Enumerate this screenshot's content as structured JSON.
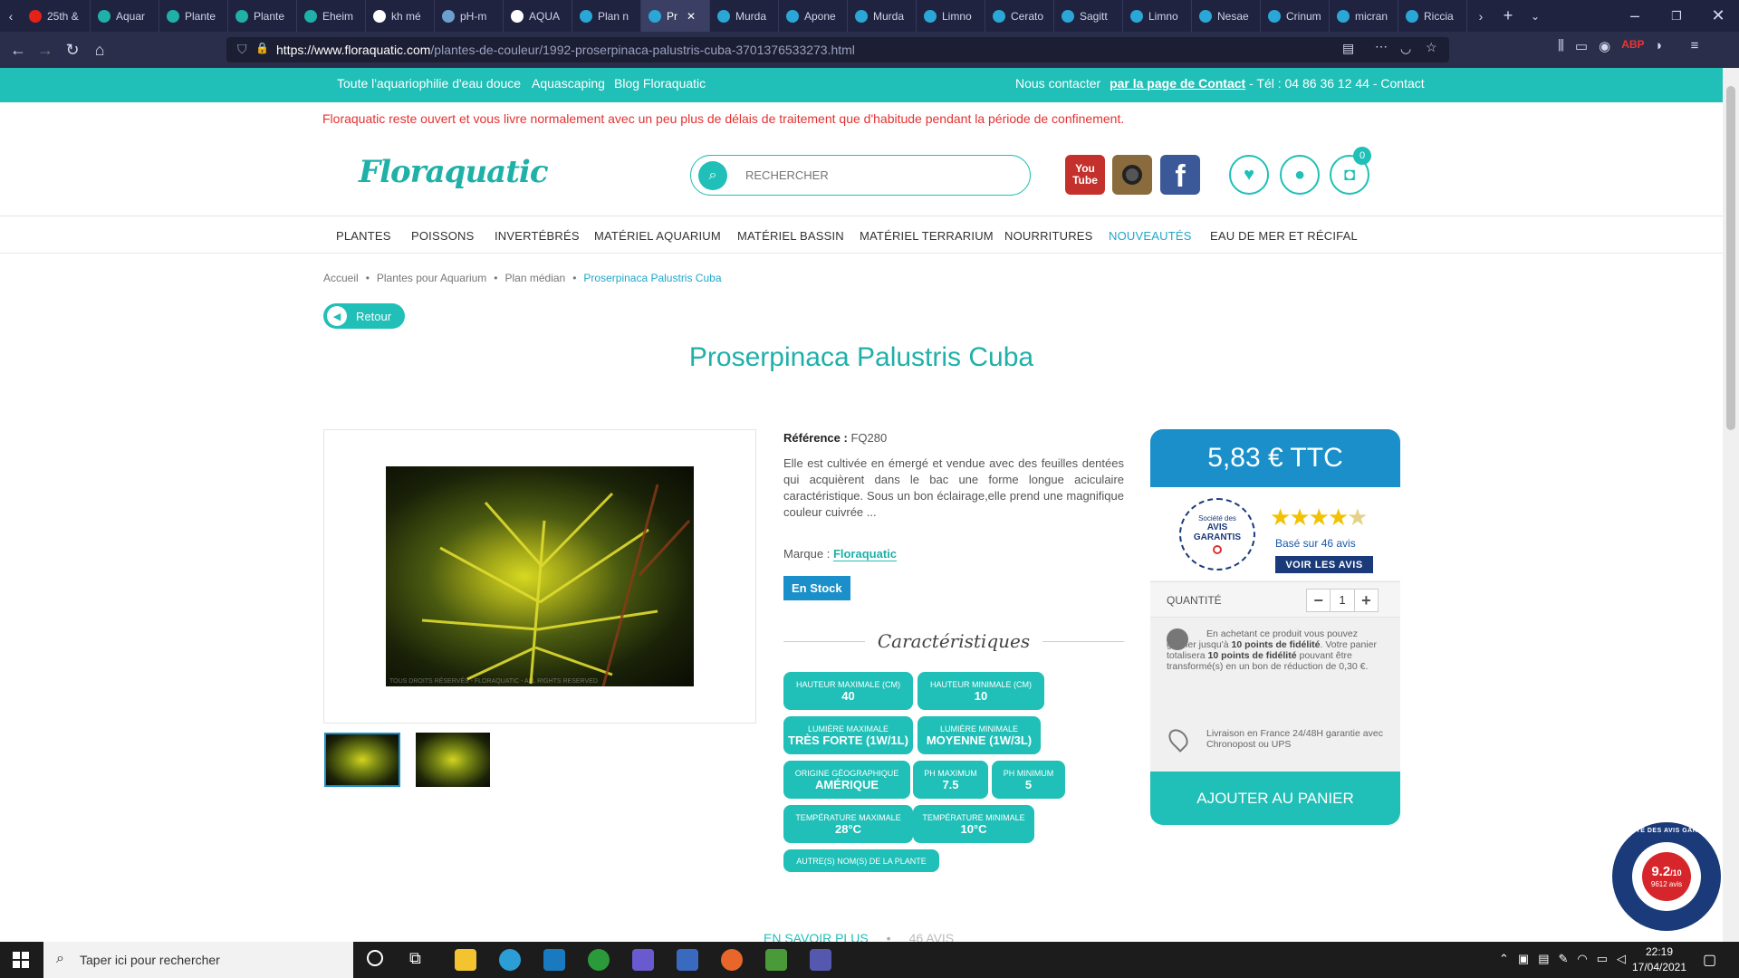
{
  "browser": {
    "tabs": [
      "25th &",
      "Aquar",
      "Plante",
      "Plante",
      "Eheim",
      "kh mé",
      "pH-m",
      "AQUA",
      "Plan n",
      "Pr",
      "Murda",
      "Apone",
      "Murda",
      "Limno",
      "Cerato",
      "Sagitt",
      "Limno",
      "Nesae",
      "Crinum",
      "micran",
      "Riccia"
    ],
    "url_domain": "https://www.floraquatic.com",
    "url_path": "/plantes-de-couleur/1992-proserpinaca-palustris-cuba-3701376533273.html"
  },
  "topbar": {
    "links": [
      "Toute l'aquariophilie d'eau douce",
      "Aquascaping",
      "Blog Floraquatic"
    ],
    "contact_prefix": "Nous contacter",
    "contact_link": "par la page de Contact",
    "contact_suffix": " - Tél : 04 86 36 12 44 - Contact"
  },
  "notice": "Floraquatic reste ouvert et vous livre normalement avec un peu plus de délais de traitement que d'habitude pendant la période de confinement.",
  "header": {
    "logo": "Floraquatic",
    "search_placeholder": "RECHERCHER",
    "cart_count": "0"
  },
  "menu": [
    "PLANTES",
    "POISSONS",
    "INVERTÉBRÉS",
    "MATÉRIEL AQUARIUM",
    "MATÉRIEL BASSIN",
    "MATÉRIEL TERRARIUM",
    "NOURRITURES",
    "NOUVEAUTÉS",
    "EAU DE MER ET RÉCIFAL"
  ],
  "breadcrumb": [
    "Accueil",
    "Plantes pour Aquarium",
    "Plan médian",
    "Proserpinaca Palustris Cuba"
  ],
  "back_label": "Retour",
  "product": {
    "title": "Proserpinaca Palustris Cuba",
    "ref_label": "Référence :",
    "ref_value": "FQ280",
    "description": "Elle est cultivée en émergé et vendue avec des feuilles dentées qui acquièrent dans le bac une forme longue aciculaire caractéristique. Sous un bon éclairage,elle prend une magnifique couleur cuivrée ...",
    "brand_label": "Marque :",
    "brand": "Floraquatic",
    "stock": "En Stock",
    "image_watermark": "TOUS DROITS RÉSERVÉS - FLORAQUATIC - ALL RIGHTS RESERVED"
  },
  "caracteristiques": {
    "title": "Caractéristiques",
    "items": [
      {
        "label": "HAUTEUR MAXIMALE (CM)",
        "value": "40"
      },
      {
        "label": "HAUTEUR MINIMALE (CM)",
        "value": "10"
      },
      {
        "label": "LUMIÈRE MAXIMALE",
        "value": "TRÈS FORTE (1W/1L)"
      },
      {
        "label": "LUMIÈRE MINIMALE",
        "value": "MOYENNE (1W/3L)"
      },
      {
        "label": "ORIGINE GÉOGRAPHIQUE",
        "value": "AMÉRIQUE"
      },
      {
        "label": "PH MAXIMUM",
        "value": "7.5"
      },
      {
        "label": "PH MINIMUM",
        "value": "5"
      },
      {
        "label": "TEMPÉRATURE MAXIMALE",
        "value": "28°C"
      },
      {
        "label": "TEMPÉRATURE MINIMALE",
        "value": "10°C"
      },
      {
        "label": "AUTRE(S) NOM(S) DE LA PLANTE",
        "value": ""
      }
    ]
  },
  "price": {
    "amount": "5,83 € TTC",
    "avis_badge_line1": "Société des",
    "avis_badge_line2": "AVIS",
    "avis_badge_line3": "GARANTIS",
    "rating_stars": 4.5,
    "based_on": "Basé sur 46 avis",
    "voir_avis": "VOIR LES AVIS",
    "qty_label": "QUANTITÉ",
    "qty_value": "1",
    "loyalty_text_1": "En achetant ce produit vous pouvez gagner jusqu'à ",
    "loyalty_bold_1": "10 points de fidélité",
    "loyalty_text_2": ". Votre panier totalisera ",
    "loyalty_bold_2": "10 points de fidélité",
    "loyalty_text_3": " pouvant être transformé(s) en un bon de réduction de 0,30 €.",
    "shipping": "Livraison en France 24/48H garantie avec Chronopost ou UPS",
    "add_to_cart": "AJOUTER AU PANIER"
  },
  "bottom_tabs": [
    "EN SAVOIR PLUS",
    "46 AVIS"
  ],
  "avis_seal": {
    "score": "9.2",
    "scale": "/10",
    "count": "9612 avis",
    "ring_text": "SOCIÉTÉ DES AVIS GARANTIS"
  },
  "taskbar": {
    "search_placeholder": "Taper ici pour rechercher",
    "time": "22:19",
    "date": "17/04/2021"
  },
  "colors": {
    "teal": "#20bfb7",
    "blue": "#1a8fc9",
    "notice_red": "#e53030"
  }
}
